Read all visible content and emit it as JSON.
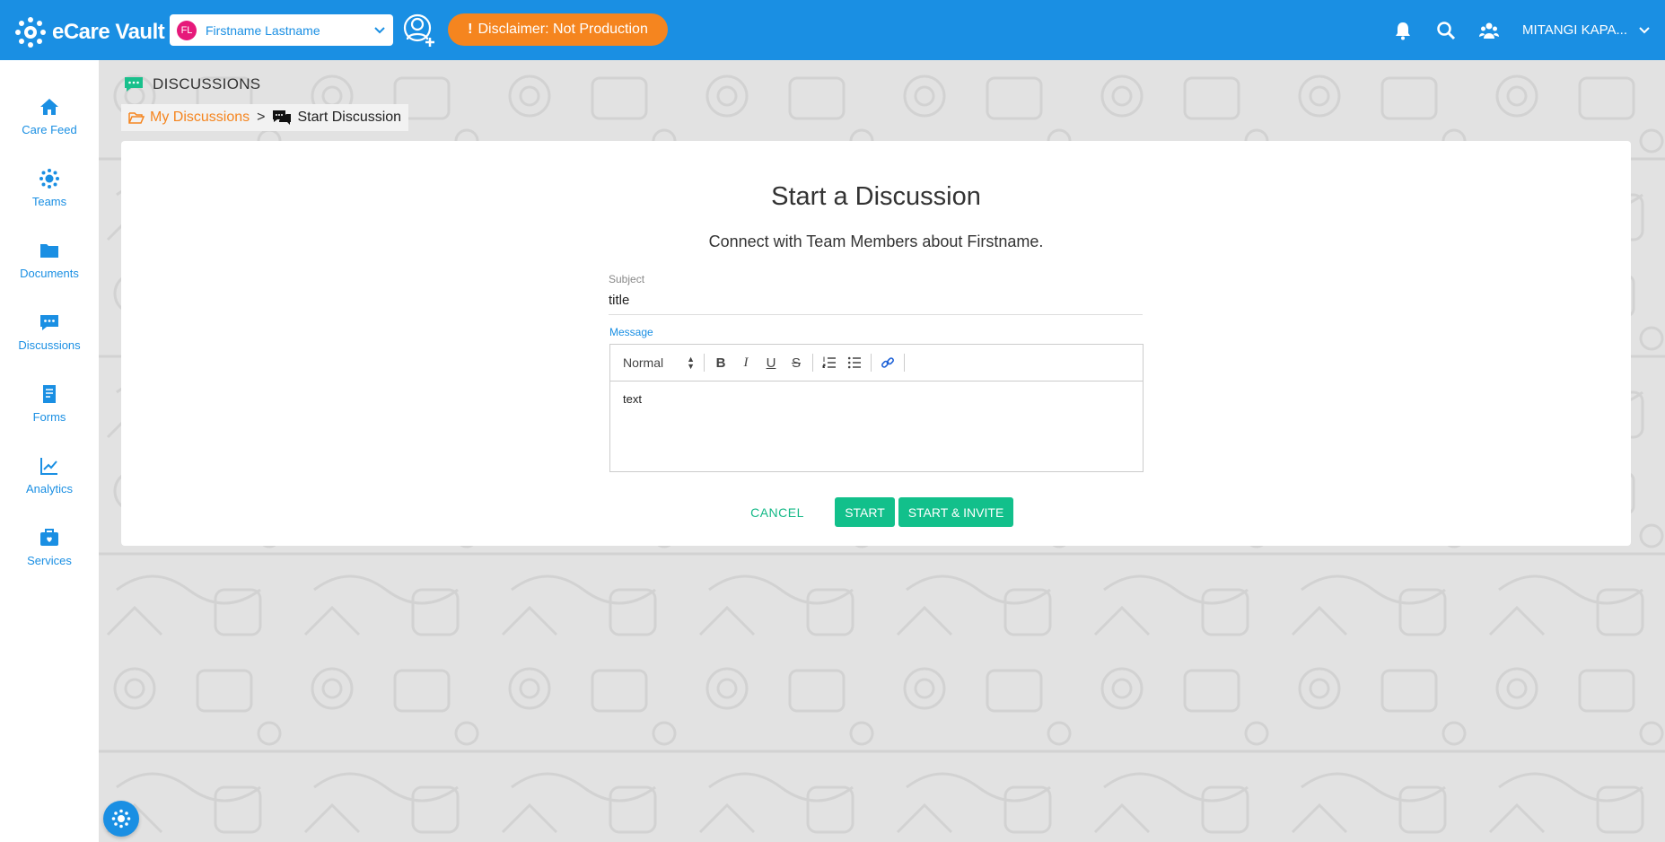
{
  "app": {
    "name": "eCare Vault"
  },
  "header": {
    "patient": {
      "initials": "FL",
      "name": "Firstname Lastname",
      "avatar_color": "#e6197a"
    },
    "disclaimer": "Disclaimer: Not Production",
    "username": "MITANGI KAPA...",
    "icons": [
      "add-user-icon",
      "bell-icon",
      "search-icon",
      "team-icon",
      "chevron-down-icon"
    ]
  },
  "sidebar": {
    "items": [
      {
        "label": "Care Feed",
        "icon": "home-icon"
      },
      {
        "label": "Teams",
        "icon": "team-icon"
      },
      {
        "label": "Documents",
        "icon": "folder-icon"
      },
      {
        "label": "Discussions",
        "icon": "chat-icon"
      },
      {
        "label": "Forms",
        "icon": "form-icon"
      },
      {
        "label": "Analytics",
        "icon": "chart-icon"
      },
      {
        "label": "Services",
        "icon": "briefcase-icon"
      }
    ]
  },
  "section": {
    "title": "DISCUSSIONS"
  },
  "breadcrumb": {
    "parent": "My Discussions",
    "separator": ">",
    "current": "Start Discussion"
  },
  "form": {
    "title": "Start a Discussion",
    "subtitle": "Connect with Team Members about Firstname.",
    "subject_label": "Subject",
    "subject_value": "title",
    "message_label": "Message",
    "format_select": "Normal",
    "toolbar": {
      "bold": "B",
      "italic": "I",
      "underline": "U",
      "strike": "S"
    },
    "message_value": "text",
    "cancel_label": "CANCEL",
    "start_label": "START",
    "start_invite_label": "START & INVITE"
  },
  "colors": {
    "primary": "#1a8fe3",
    "accent_orange": "#f5851f",
    "success": "#12c08b"
  }
}
